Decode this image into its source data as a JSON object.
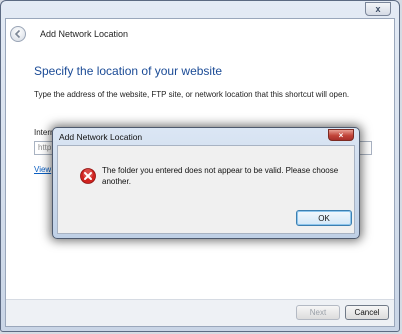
{
  "wizard": {
    "title": "Add Network Location",
    "close_glyph": "x",
    "heading": "Specify the location of your website",
    "instruction": "Type the address of the website, FTP site, or network location that this shortcut will open.",
    "address_label_partial": "Intern",
    "address_label_trailing": "...",
    "address_value_partial": "http:",
    "browse_link_partial": "View",
    "buttons": {
      "next": "Next",
      "cancel": "Cancel"
    }
  },
  "dialog": {
    "title": "Add Network Location",
    "message": "The folder you entered does not appear to be valid.  Please choose another.",
    "ok": "OK"
  },
  "icons": {
    "back": "back-arrow-icon",
    "error": "error-icon",
    "close": "close-icon"
  },
  "colors": {
    "heading": "#1b4b96",
    "error": "#d0231f",
    "link": "#0b5fc2"
  }
}
